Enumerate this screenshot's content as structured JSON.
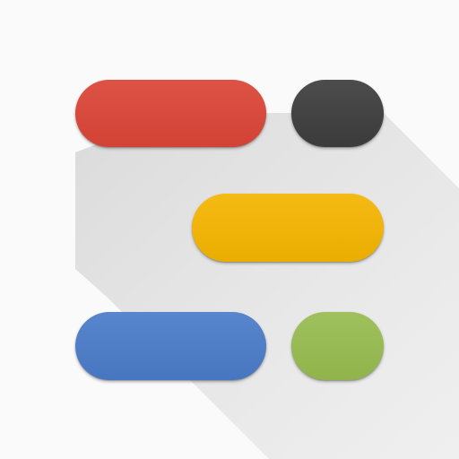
{
  "icon": {
    "name": "app-icon",
    "colors": {
      "background": "#fafafa",
      "shadow": "#dcdcdc",
      "red": "#db4437",
      "black": "#3d3d3d",
      "yellow": "#f4b400",
      "blue": "#4a7bc8",
      "green": "#97bb4f"
    }
  }
}
